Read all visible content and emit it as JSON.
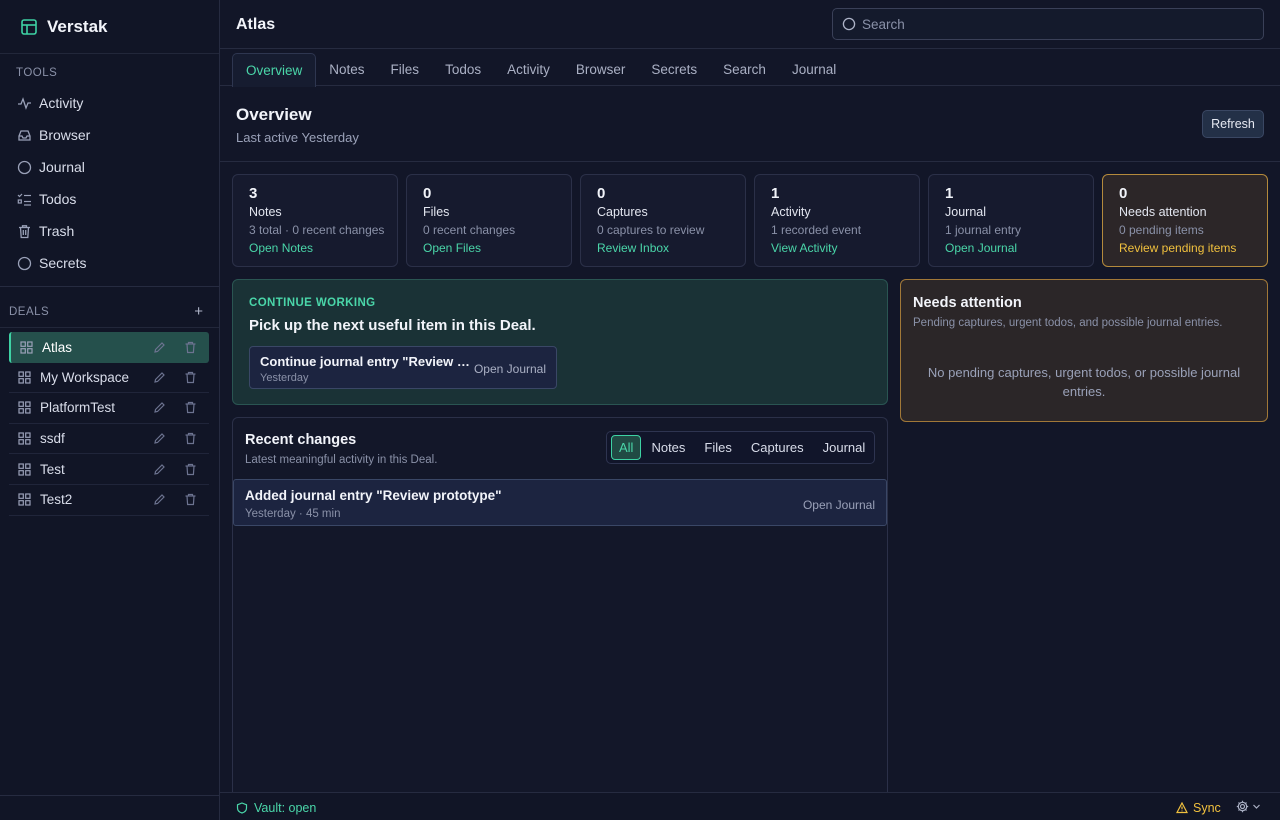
{
  "app": {
    "name": "Verstak"
  },
  "sidebar": {
    "tools_label": "TOOLS",
    "tools": [
      {
        "label": "Activity",
        "icon": "activity-icon"
      },
      {
        "label": "Browser",
        "icon": "inbox-icon"
      },
      {
        "label": "Journal",
        "icon": "circle-icon"
      },
      {
        "label": "Todos",
        "icon": "list-checks-icon"
      },
      {
        "label": "Trash",
        "icon": "trash-icon"
      },
      {
        "label": "Secrets",
        "icon": "circle-icon"
      }
    ],
    "deals_label": "DEALS",
    "add_label": "+",
    "deals": [
      {
        "label": "Atlas",
        "active": true
      },
      {
        "label": "My Workspace"
      },
      {
        "label": "PlatformTest"
      },
      {
        "label": "ssdf"
      },
      {
        "label": "Test"
      },
      {
        "label": "Test2"
      }
    ]
  },
  "header": {
    "title": "Atlas",
    "search_placeholder": "Search"
  },
  "tabs": [
    "Overview",
    "Notes",
    "Files",
    "Todos",
    "Activity",
    "Browser",
    "Secrets",
    "Search",
    "Journal"
  ],
  "active_tab": "Overview",
  "overview": {
    "title": "Overview",
    "subtitle": "Last active Yesterday",
    "refresh_label": "Refresh"
  },
  "stats": [
    {
      "number": "3",
      "label": "Notes",
      "desc": "3 total · 0 recent changes",
      "link": "Open Notes"
    },
    {
      "number": "0",
      "label": "Files",
      "desc": "0 recent changes",
      "link": "Open Files"
    },
    {
      "number": "0",
      "label": "Captures",
      "desc": "0 captures to review",
      "link": "Review Inbox"
    },
    {
      "number": "1",
      "label": "Activity",
      "desc": "1 recorded event",
      "link": "View Activity"
    },
    {
      "number": "1",
      "label": "Journal",
      "desc": "1 journal entry",
      "link": "Open Journal"
    },
    {
      "number": "0",
      "label": "Needs attention",
      "desc": "0 pending items",
      "link": "Review pending items",
      "warn": true
    }
  ],
  "continue_working": {
    "label": "CONTINUE WORKING",
    "title": "Pick up the next useful item in this Deal.",
    "item_title": "Continue journal entry \"Review prototype\"",
    "item_sub": "Yesterday",
    "item_action": "Open Journal"
  },
  "needs_attention": {
    "title": "Needs attention",
    "subtitle": "Pending captures, urgent todos, and possible journal entries.",
    "empty": "No pending captures, urgent todos, or possible journal entries."
  },
  "recent": {
    "title": "Recent changes",
    "subtitle": "Latest meaningful activity in this Deal.",
    "filters": [
      "All",
      "Notes",
      "Files",
      "Captures",
      "Journal"
    ],
    "active_filter": "All",
    "items": [
      {
        "title": "Added journal entry \"Review prototype\"",
        "meta": "Yesterday · 45 min",
        "action": "Open Journal"
      }
    ]
  },
  "statusbar": {
    "vault": "Vault: open",
    "sync": "Sync"
  },
  "colors": {
    "accent": "#4ad6a9",
    "warning": "#f0c03e",
    "background": "#121628"
  }
}
